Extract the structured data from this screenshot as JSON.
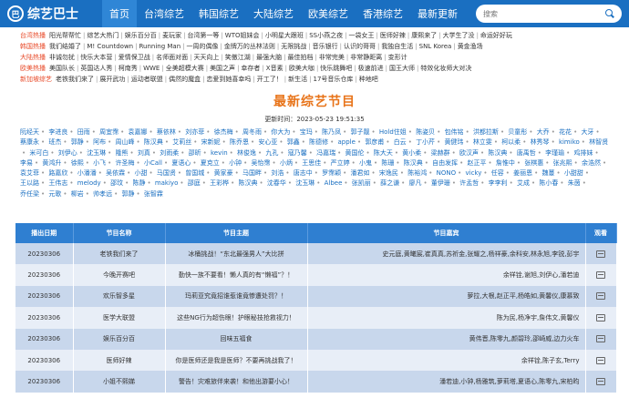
{
  "header": {
    "logo_text": "综艺巴士",
    "logo_badge": "巴",
    "nav": [
      {
        "label": "首页",
        "active": true
      },
      {
        "label": "台湾综艺",
        "active": false
      },
      {
        "label": "韩国综艺",
        "active": false
      },
      {
        "label": "大陆综艺",
        "active": false
      },
      {
        "label": "欧美综艺",
        "active": false
      },
      {
        "label": "香港综艺",
        "active": false
      },
      {
        "label": "最新更新",
        "active": false
      }
    ],
    "search_placeholder": "搜索"
  },
  "hot_rows": [
    {
      "label": "台湾热播",
      "items": [
        "阳光帮帮忙",
        "综艺大热门",
        "娱乐百分百",
        "麦玩家",
        "台湾第一等",
        "WTO姐妹会",
        "小明星大跟班",
        "SS小燕之夜",
        "一袋女王",
        "医师好辣",
        "康熙来了",
        "大学生了没",
        "命运好好玩"
      ]
    },
    {
      "label": "韩国热播",
      "items": [
        "我们结婚了",
        "M! Countdown",
        "Running Man",
        "一周的偶像",
        "金牌万的丛林法则",
        "无限挑战",
        "音乐银行",
        "认识的哥哥",
        "我独自生活",
        "SNL Korea",
        "黄金渔场"
      ]
    },
    {
      "label": "大陆热播",
      "items": [
        "非诚勿扰",
        "快乐大本营",
        "爱情保卫战",
        "名师面对面",
        "天天向上",
        "笑傲江湖",
        "最强大脑",
        "最佳拍档",
        "非常完美",
        "非常静距离",
        "变形计"
      ]
    },
    {
      "label": "欧美热播",
      "items": [
        "美国队长",
        "英国达人秀",
        "柯南秀",
        "WWE",
        "全美超模大赛",
        "美国之声",
        "幸存者",
        "X音素",
        "欧美大咖",
        "快乐跳舞吧",
        "极速前进",
        "国王大师",
        "特效化妆师大对决"
      ]
    },
    {
      "label": "新加坡综艺",
      "items": [
        "老铁我们来了",
        "展开武功",
        "运动者联盟",
        "偶然的魔盒",
        "恋爱到她喜幸吗",
        "开工了！",
        "新生活",
        "17号音乐仓库",
        "种地吧"
      ]
    }
  ],
  "title": "最新综艺节目",
  "update_label": "更新时间：",
  "update_time": "2023-05-23 19:51:35",
  "stars": [
    "阮经天",
    "李进良",
    "田雨",
    "周宜霈",
    "袁嘉娜",
    "蔡依林",
    "刘亦菲",
    "徐杰梅",
    "周冬雨",
    "你大为",
    "宝玛",
    "陈乃凤",
    "郭子靓",
    "Hold住姐",
    "陈姿贝",
    "包伟铭",
    "洪都拉斯",
    "贝童彤",
    "大乔",
    "花花",
    "大牙",
    "蔡康永",
    "班杰",
    "郭静",
    "阿布",
    "周山峰",
    "陈汉典",
    "艾莉丝",
    "宋新妮",
    "陈乔恩",
    "安心亚",
    "郭鑫",
    "陈德修",
    "apple",
    "郭彦甫",
    "白云",
    "丁小芹",
    "黄健玮",
    "林立雯",
    "柯以柔",
    "林秀琴",
    "kimiko",
    "林智贤",
    "米可白",
    "刘伊心",
    "沈玉琳",
    "隆熊",
    "刘真",
    "刘雨柔",
    "邵昕",
    "kevin",
    "林俊逸",
    "九孔",
    "寇乃馨",
    "冯嘉瑞",
    "黄国伦",
    "陈大天",
    "黄小柔",
    "梁赫群",
    "欧汉声",
    "陈汉典",
    "唐禹哲",
    "李瑾瑜",
    "鸡排妹",
    "李易",
    "黄鸿升",
    "徐熙",
    "小飞",
    "许圣梅",
    "小Call",
    "夏语心",
    "夏克立",
    "小钟",
    "吴怡霈",
    "小炳",
    "王思佳",
    "严立婷",
    "小鬼",
    "陈珊",
    "陈汉典",
    "自由发挥",
    "赵正平",
    "詹惟中",
    "张棋惠",
    "张兆熙",
    "余浩然",
    "袁艾菲",
    "路嘉欣",
    "小潘潘",
    "吴依霖",
    "小甜",
    "马国贤",
    "曾国城",
    "黄家豪",
    "马国畔",
    "刘浩",
    "唐志中",
    "罗霈颖",
    "潘君如",
    "宋逸民",
    "陈裕鸿",
    "NONO",
    "vicky",
    "任容",
    "姜丽恩",
    "魏蔓",
    "小甜甜",
    "王以路",
    "王伟志",
    "melody",
    "邵玟",
    "陈静",
    "makiyo",
    "邵庭",
    "王彩桦",
    "陈汉典",
    "沈春华",
    "沈玉琳",
    "Albee",
    "张凯丽",
    "薛之谦",
    "廖凡",
    "董伊珊",
    "许孟哲",
    "李李利",
    "艾成",
    "陈小春",
    "朱茵",
    "乔任梁",
    "元歌",
    "柳岩",
    "帅孝远",
    "郭静",
    "张智霖"
  ],
  "table": {
    "headers": [
      "播出日期",
      "节目名称",
      "节目主题",
      "节目嘉宾",
      "观看"
    ],
    "rows": [
      {
        "date": "20230306",
        "program": "老铁我们来了",
        "topic": "冰桶挑战！“东北最强男人”大比拼",
        "guests": "史元庭,黄曦宸,崔真真,苏祈金,张耀之,杨祥豪,余科安,林永旭,李锐,彭宇"
      },
      {
        "date": "20230306",
        "program": "今晚开赛吧",
        "topic": "勤快一族不要看！懒人真的有“懒福”？！",
        "guests": "余祥铨,谢旭,刘伊心,潘若迪"
      },
      {
        "date": "20230306",
        "program": "欢乐智多星",
        "topic": "玛莉亚究竟招谁惹谁竟惨遭处罚？！",
        "guests": "萝拉,大根,赵正平,杨皓如,黄馨仪,康慕致"
      },
      {
        "date": "20230306",
        "program": "医学大联盟",
        "topic": "这些NG行为超伤眼！护眼秘技抢救视力！",
        "guests": "陈为民,杨净宇,詹伟文,黄馨仪"
      },
      {
        "date": "20230306",
        "program": "娱乐百分百",
        "topic": "回味五福食",
        "guests": "黄伟晋,陈零九,颜碧玲,邵崎威,边力火车"
      },
      {
        "date": "20230306",
        "program": "医师好辣",
        "topic": "你是医师还是我是医师？不要再挑战我了！",
        "guests": "余祥铨,陈子玄,Terry"
      },
      {
        "date": "20230306",
        "program": "小姐不熙娣",
        "topic": "警告！灾难旅伴来袭！和他出游要小心！",
        "guests": "潘若迪,小钟,杨雅筑,萝莉塔,夏语心,陈零九,宋柏昀"
      }
    ]
  },
  "colors": {
    "header_bg": "#1a6fc1",
    "accent_orange": "#e8741a",
    "hot_label": "#e84b2a",
    "table_head": "#2f7fd1"
  }
}
